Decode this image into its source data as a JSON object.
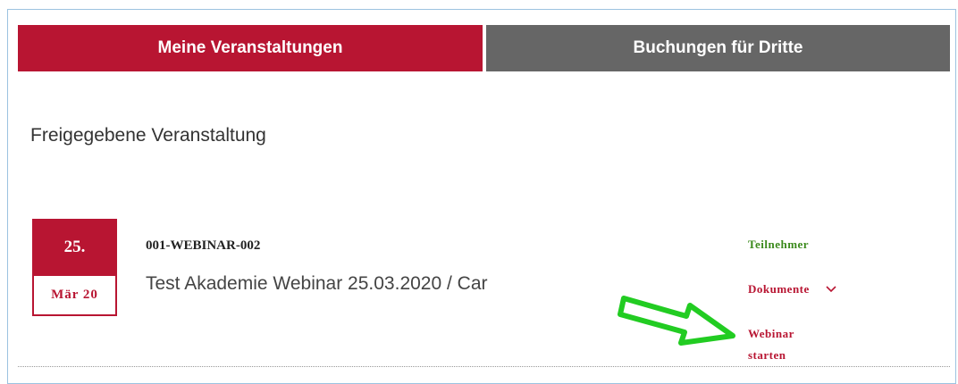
{
  "tabs": {
    "active_label": "Meine Veranstaltungen",
    "inactive_label": "Buchungen für Dritte"
  },
  "section": {
    "title": "Freigegebene Veranstaltung"
  },
  "event": {
    "day": "25.",
    "month": "Mär 20",
    "code": "001-WEBINAR-002",
    "title": "Test Akademie Webinar 25.03.2020 / Car",
    "actions": {
      "participants": "Teilnehmer",
      "documents": "Dokumente",
      "start_webinar_line1": "Webinar",
      "start_webinar_line2": "starten"
    }
  },
  "icons": {
    "chevron": "chevron-down-icon",
    "annotation_arrow": "arrow-annotation-icon"
  },
  "colors": {
    "brand_red": "#b81532",
    "tab_gray": "#666666",
    "participants_green": "#3b8a1c",
    "arrow_green": "#22cc22"
  }
}
